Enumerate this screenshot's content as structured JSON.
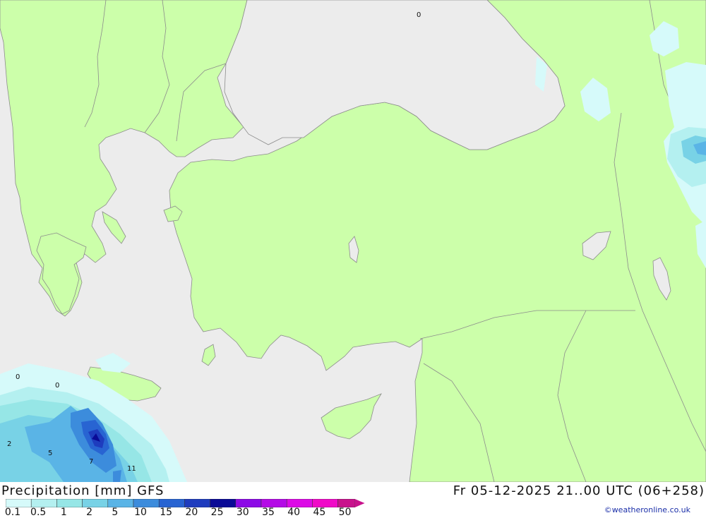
{
  "title": "Precipitation [mm] GFS",
  "valid_time": "Fr 05-12-2025 21..00 UTC (06+258)",
  "credit": "©weatheronline.co.uk",
  "legend": {
    "labels": [
      "0.1",
      "0.5",
      "1",
      "2",
      "5",
      "10",
      "15",
      "20",
      "25",
      "30",
      "35",
      "40",
      "45",
      "50"
    ],
    "colors": [
      "#d6fafa",
      "#b4f0f0",
      "#96e6e6",
      "#78d2e6",
      "#5ab4e6",
      "#3c8cdc",
      "#2864d2",
      "#1e3cbe",
      "#0a0a96",
      "#8c0ae6",
      "#b40ae6",
      "#dc0ae6",
      "#f00ac8",
      "#c8128c"
    ]
  },
  "map_colors": {
    "sea": "#ececec",
    "land": "#ccffaa",
    "border": "#8c8c8c"
  },
  "contour_labels": [
    "0",
    "0",
    "0",
    "2",
    "5",
    "7",
    "11"
  ]
}
